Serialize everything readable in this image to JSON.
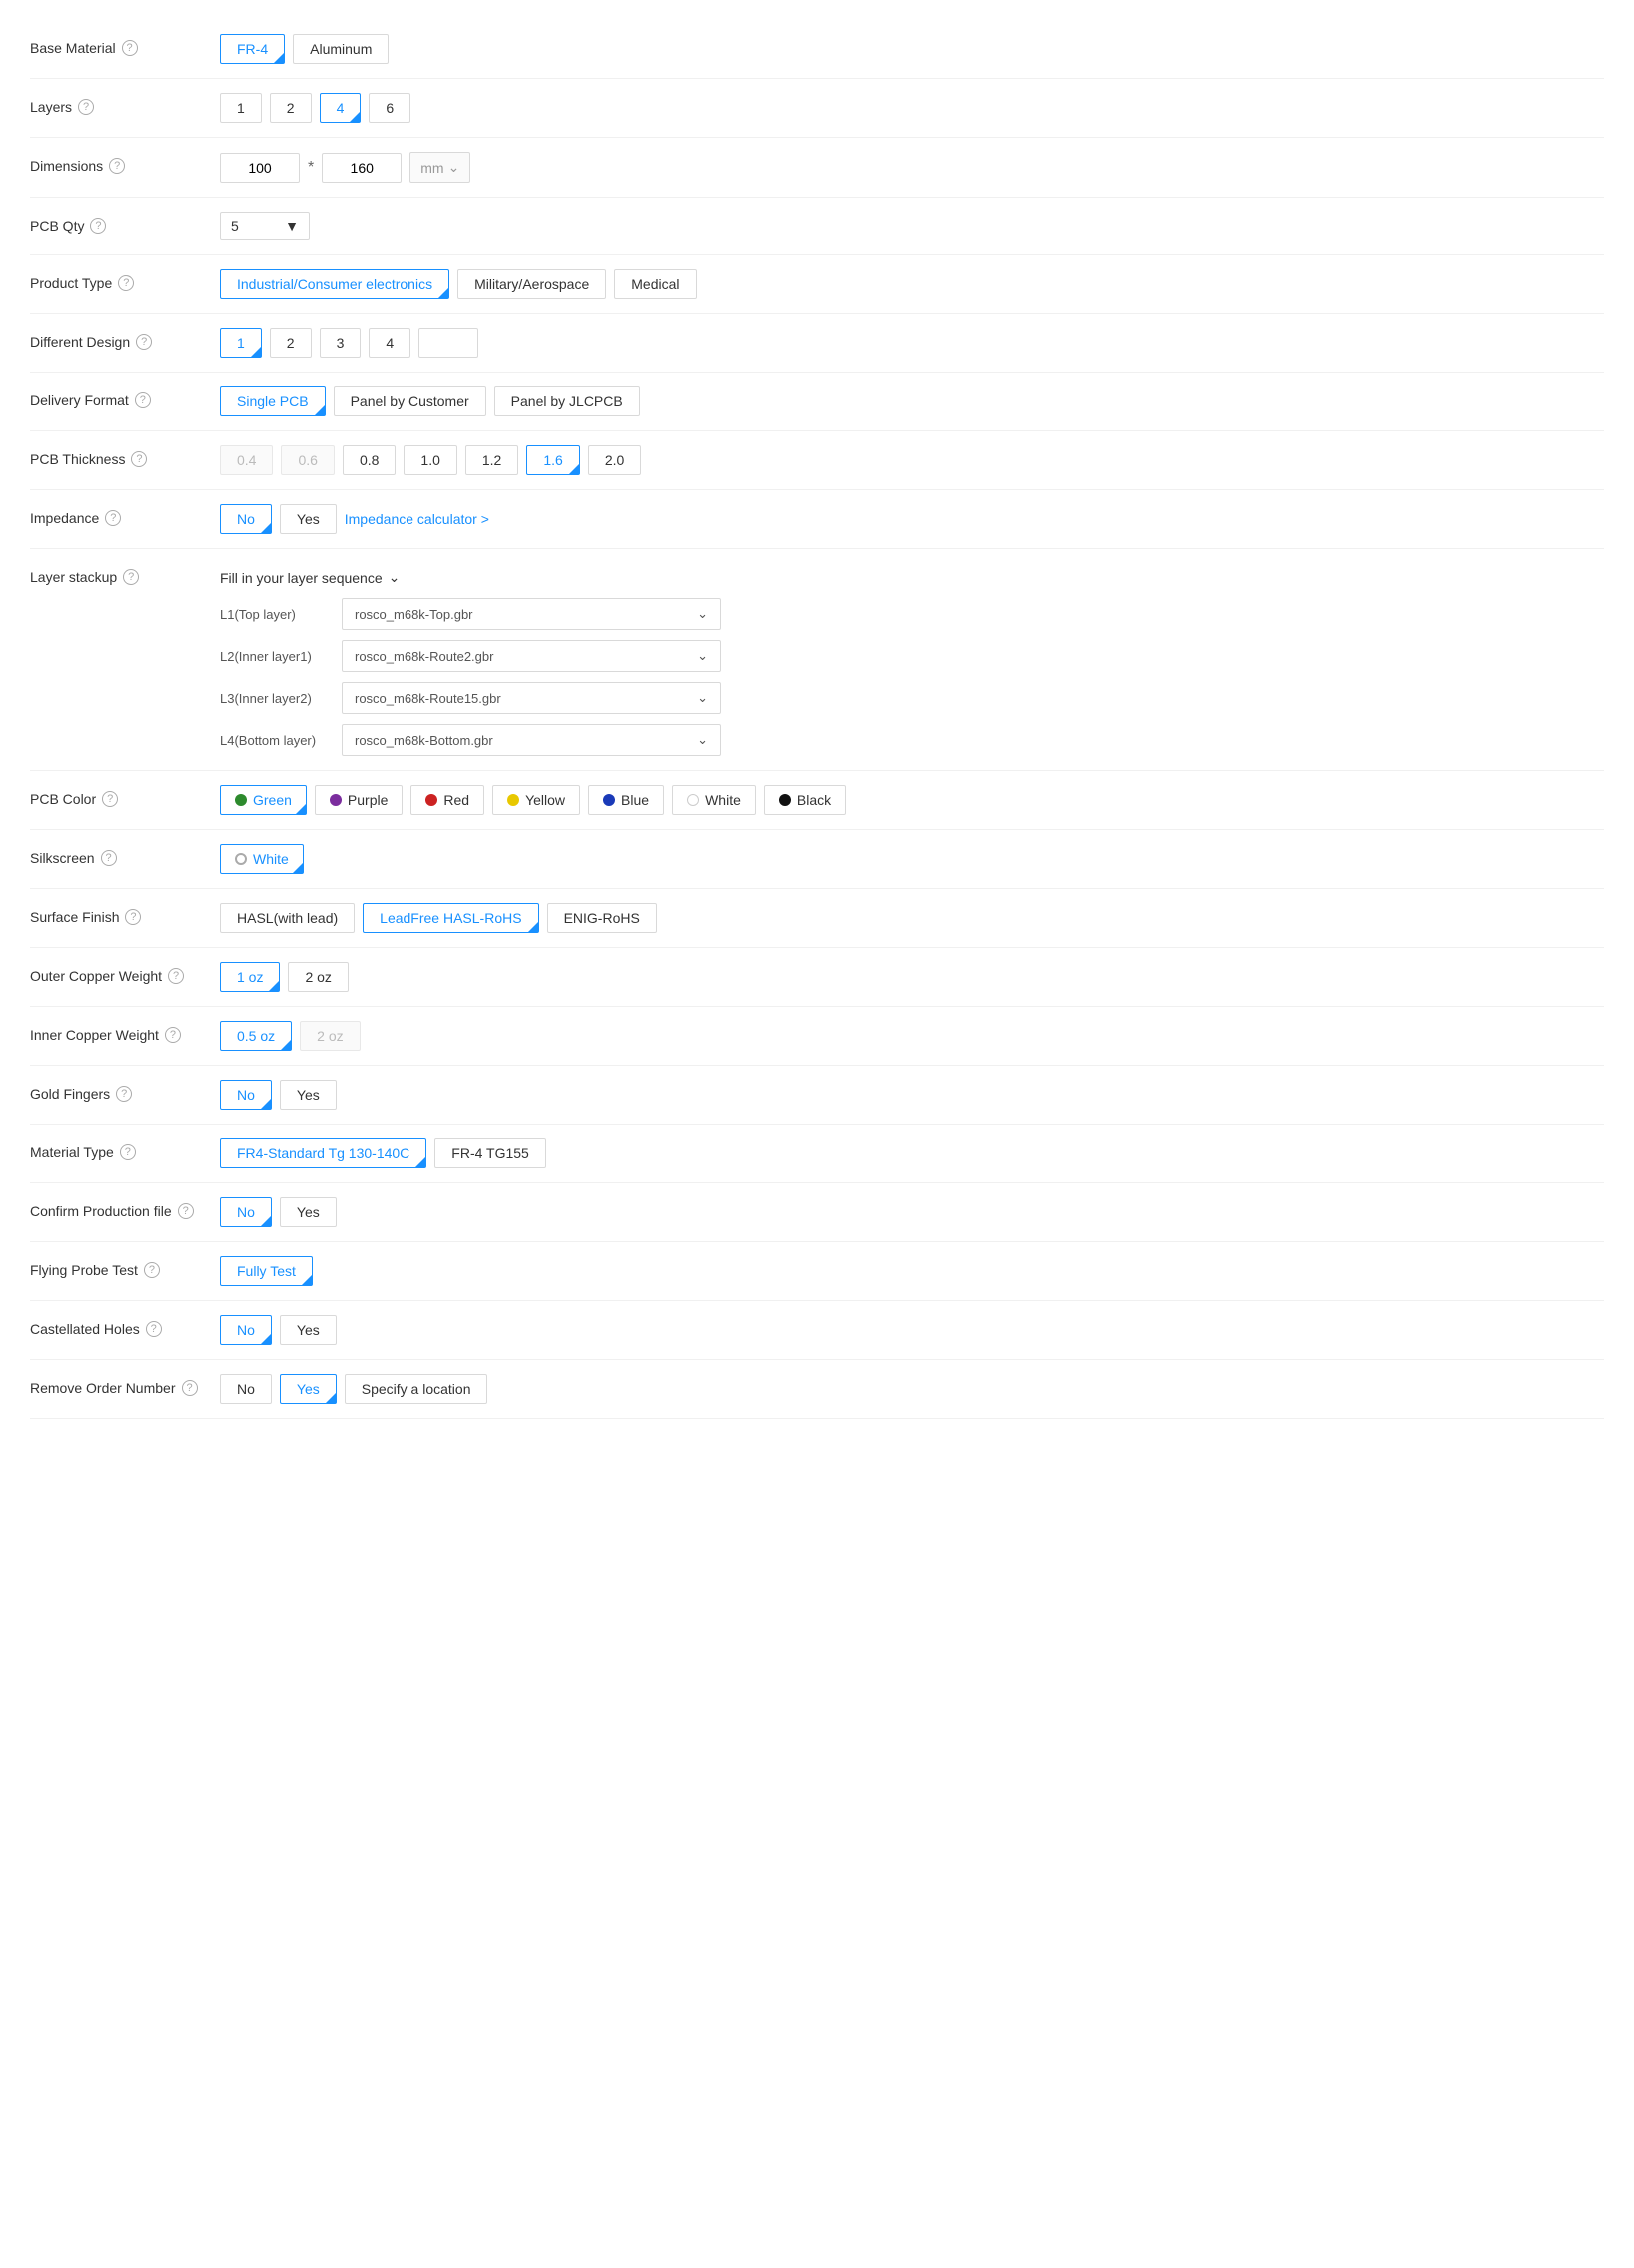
{
  "fields": {
    "base_material": {
      "label": "Base Material",
      "options": [
        "FR-4",
        "Aluminum"
      ],
      "selected": "FR-4"
    },
    "layers": {
      "label": "Layers",
      "options": [
        "1",
        "2",
        "4",
        "6"
      ],
      "selected": "4"
    },
    "dimensions": {
      "label": "Dimensions",
      "width": "100",
      "height": "160",
      "unit": "mm"
    },
    "pcb_qty": {
      "label": "PCB Qty",
      "value": "5"
    },
    "product_type": {
      "label": "Product Type",
      "options": [
        "Industrial/Consumer electronics",
        "Military/Aerospace",
        "Medical"
      ],
      "selected": "Industrial/Consumer electronics"
    },
    "different_design": {
      "label": "Different Design",
      "options": [
        "1",
        "2",
        "3",
        "4",
        ""
      ],
      "selected": "1"
    },
    "delivery_format": {
      "label": "Delivery Format",
      "options": [
        "Single PCB",
        "Panel by Customer",
        "Panel by JLCPCB"
      ],
      "selected": "Single PCB"
    },
    "pcb_thickness": {
      "label": "PCB Thickness",
      "options": [
        "0.4",
        "0.6",
        "0.8",
        "1.0",
        "1.2",
        "1.6",
        "2.0"
      ],
      "selected": "1.6",
      "disabled": [
        "0.4",
        "0.6"
      ]
    },
    "impedance": {
      "label": "Impedance",
      "options": [
        "No",
        "Yes"
      ],
      "selected": "No",
      "link": "Impedance calculator >"
    },
    "layer_stackup": {
      "label": "Layer stackup",
      "header": "Fill in your layer sequence",
      "layers": [
        {
          "id": "L1(Top layer)",
          "value": "rosco_m68k-Top.gbr"
        },
        {
          "id": "L2(Inner layer1)",
          "value": "rosco_m68k-Route2.gbr"
        },
        {
          "id": "L3(Inner layer2)",
          "value": "rosco_m68k-Route15.gbr"
        },
        {
          "id": "L4(Bottom layer)",
          "value": "rosco_m68k-Bottom.gbr"
        }
      ]
    },
    "pcb_color": {
      "label": "PCB Color",
      "options": [
        {
          "name": "Green",
          "color": "#2d8a2d"
        },
        {
          "name": "Purple",
          "color": "#7b2d9e"
        },
        {
          "name": "Red",
          "color": "#cc2222"
        },
        {
          "name": "Yellow",
          "color": "#e8c800"
        },
        {
          "name": "Blue",
          "color": "#1a3ab8"
        },
        {
          "name": "White",
          "color": "#ffffff",
          "border": "#ccc"
        },
        {
          "name": "Black",
          "color": "#111111"
        }
      ],
      "selected": "Green"
    },
    "silkscreen": {
      "label": "Silkscreen",
      "options": [
        "White"
      ],
      "selected": "White"
    },
    "surface_finish": {
      "label": "Surface Finish",
      "options": [
        "HASL(with lead)",
        "LeadFree HASL-RoHS",
        "ENIG-RoHS"
      ],
      "selected": "LeadFree HASL-RoHS"
    },
    "outer_copper_weight": {
      "label": "Outer Copper Weight",
      "options": [
        "1 oz",
        "2 oz"
      ],
      "selected": "1 oz"
    },
    "inner_copper_weight": {
      "label": "Inner Copper Weight",
      "options": [
        "0.5 oz",
        "2 oz"
      ],
      "selected": "0.5 oz",
      "disabled": [
        "2 oz"
      ]
    },
    "gold_fingers": {
      "label": "Gold Fingers",
      "options": [
        "No",
        "Yes"
      ],
      "selected": "No"
    },
    "material_type": {
      "label": "Material Type",
      "options": [
        "FR4-Standard Tg 130-140C",
        "FR-4 TG155"
      ],
      "selected": "FR4-Standard Tg 130-140C"
    },
    "confirm_production": {
      "label": "Confirm Production file",
      "options": [
        "No",
        "Yes"
      ],
      "selected": "No"
    },
    "flying_probe": {
      "label": "Flying Probe Test",
      "options": [
        "Fully Test"
      ],
      "selected": "Fully Test"
    },
    "castellated_holes": {
      "label": "Castellated Holes",
      "options": [
        "No",
        "Yes"
      ],
      "selected": "No"
    },
    "remove_order_number": {
      "label": "Remove Order Number",
      "options": [
        "No",
        "Yes",
        "Specify a location"
      ],
      "selected": "Yes"
    }
  }
}
